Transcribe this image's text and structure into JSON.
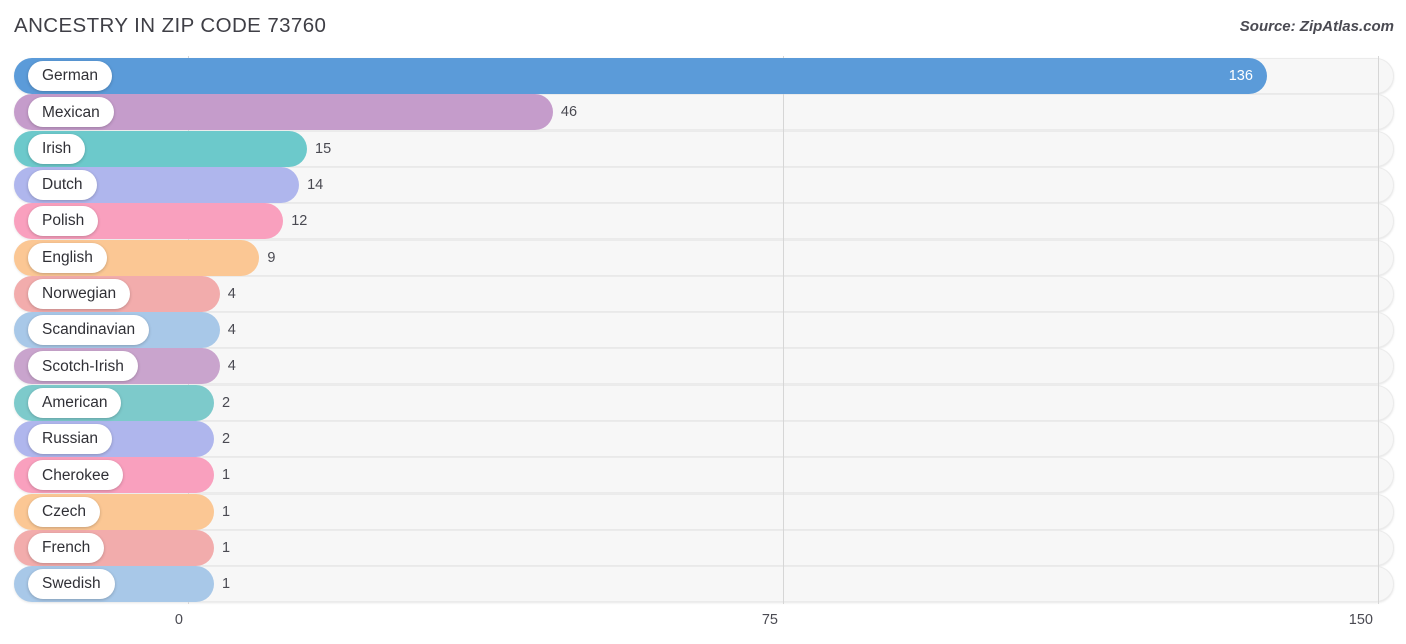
{
  "header": {
    "title": "ANCESTRY IN ZIP CODE 73760",
    "source": "Source: ZipAtlas.com"
  },
  "chart_data": {
    "type": "bar",
    "orientation": "horizontal",
    "title": "ANCESTRY IN ZIP CODE 73760",
    "xlabel": "",
    "ylabel": "",
    "xlim": [
      0,
      150
    ],
    "ticks": [
      "0",
      "75",
      "150"
    ],
    "tick_values": [
      0,
      75,
      150
    ],
    "grid": true,
    "legend": "none",
    "categories": [
      "German",
      "Mexican",
      "Irish",
      "Dutch",
      "Polish",
      "English",
      "Norwegian",
      "Scandinavian",
      "Scotch-Irish",
      "American",
      "Russian",
      "Cherokee",
      "Czech",
      "French",
      "Swedish"
    ],
    "values": [
      136,
      46,
      15,
      14,
      12,
      9,
      4,
      4,
      4,
      2,
      2,
      1,
      1,
      1,
      1
    ],
    "bars": [
      {
        "label": "German",
        "value": 136,
        "value_text": "136",
        "color": "#5B9BD9",
        "value_inside": true
      },
      {
        "label": "Mexican",
        "value": 46,
        "value_text": "46",
        "color": "#C59CCB",
        "value_inside": false
      },
      {
        "label": "Irish",
        "value": 15,
        "value_text": "15",
        "color": "#6CC9CB",
        "value_inside": false
      },
      {
        "label": "Dutch",
        "value": 14,
        "value_text": "14",
        "color": "#AFB6ED",
        "value_inside": false
      },
      {
        "label": "Polish",
        "value": 12,
        "value_text": "12",
        "color": "#F9A0BE",
        "value_inside": false
      },
      {
        "label": "English",
        "value": 9,
        "value_text": "9",
        "color": "#FBC794",
        "value_inside": false
      },
      {
        "label": "Norwegian",
        "value": 4,
        "value_text": "4",
        "color": "#F2ACAC",
        "value_inside": false
      },
      {
        "label": "Scandinavian",
        "value": 4,
        "value_text": "4",
        "color": "#A8C8E8",
        "value_inside": false
      },
      {
        "label": "Scotch-Irish",
        "value": 4,
        "value_text": "4",
        "color": "#C9A4CD",
        "value_inside": false
      },
      {
        "label": "American",
        "value": 2,
        "value_text": "2",
        "color": "#7DCACB",
        "value_inside": false
      },
      {
        "label": "Russian",
        "value": 2,
        "value_text": "2",
        "color": "#AFB6ED",
        "value_inside": false
      },
      {
        "label": "Cherokee",
        "value": 1,
        "value_text": "1",
        "color": "#F9A0BE",
        "value_inside": false
      },
      {
        "label": "Czech",
        "value": 1,
        "value_text": "1",
        "color": "#FBC794",
        "value_inside": false
      },
      {
        "label": "French",
        "value": 1,
        "value_text": "1",
        "color": "#F2ACAC",
        "value_inside": false
      },
      {
        "label": "Swedish",
        "value": 1,
        "value_text": "1",
        "color": "#A8C8E8",
        "value_inside": false
      }
    ]
  }
}
